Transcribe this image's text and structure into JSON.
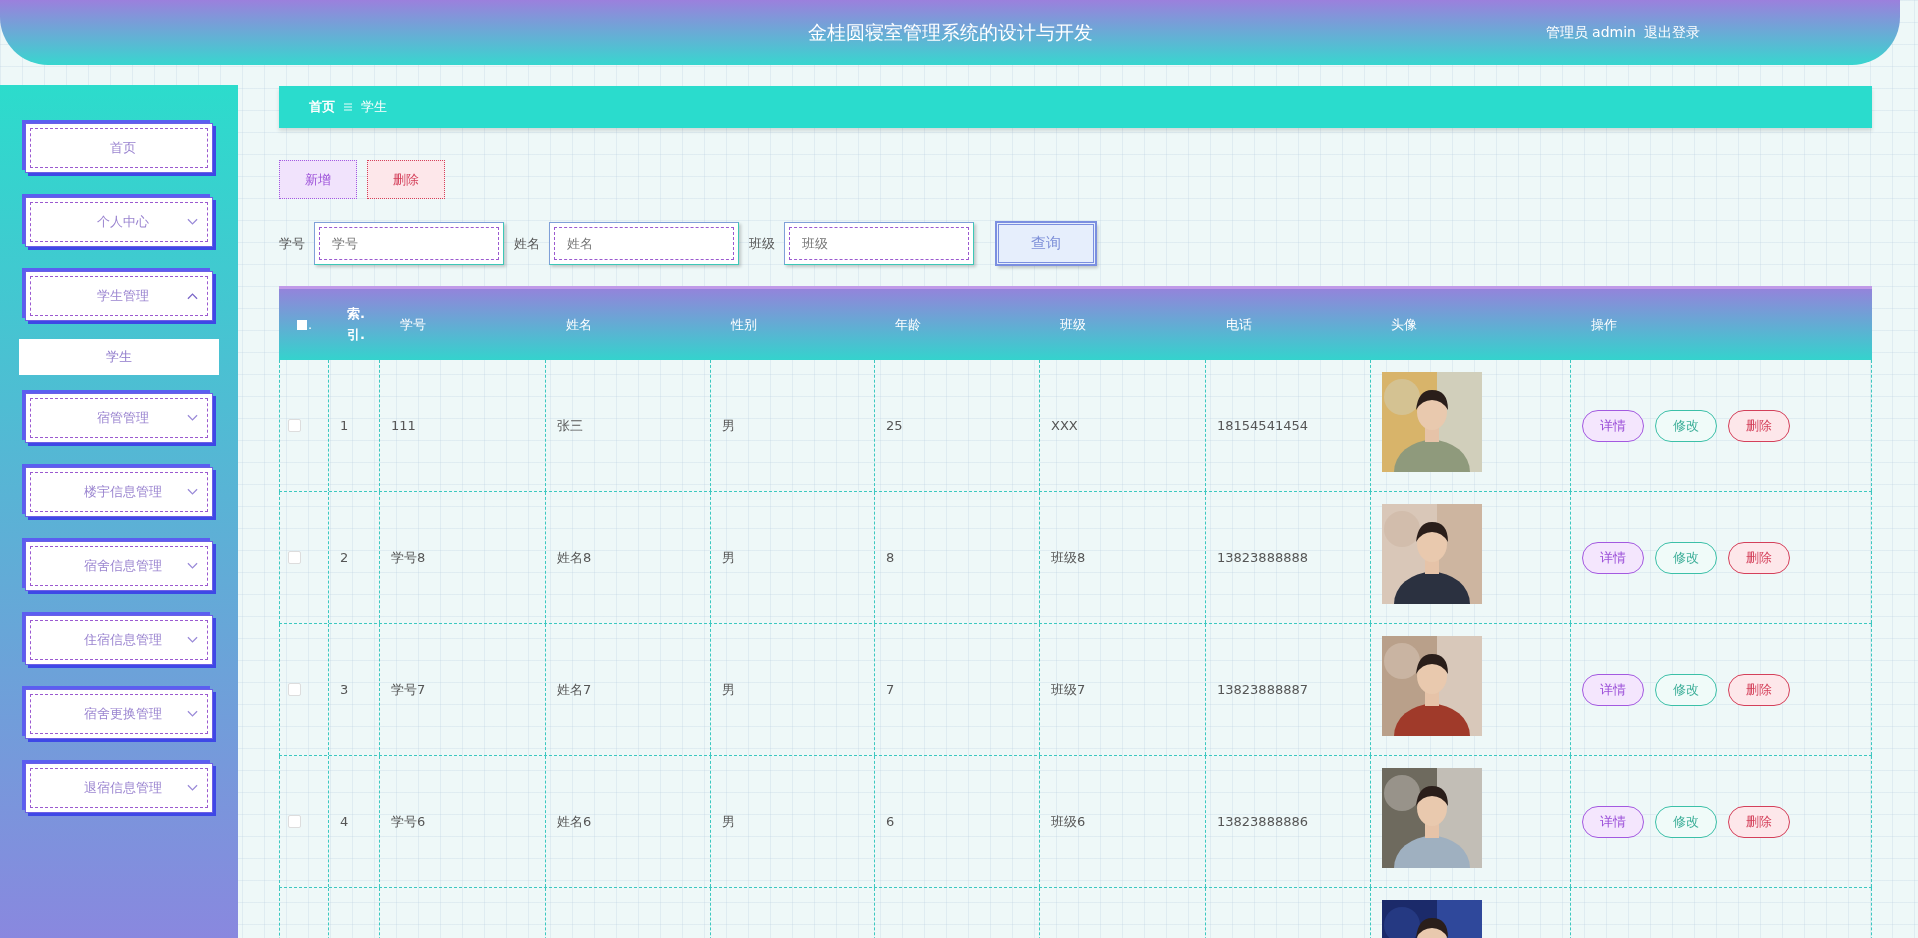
{
  "header": {
    "title": "金桂圆寝室管理系统的设计与开发",
    "user": "管理员 admin",
    "logout": "退出登录"
  },
  "sidebar": {
    "items": [
      {
        "label": "首页",
        "kind": "link"
      },
      {
        "label": "个人中心",
        "kind": "menu",
        "expanded": false
      },
      {
        "label": "学生管理",
        "kind": "menu",
        "expanded": true,
        "children": [
          {
            "label": "学生",
            "selected": true
          }
        ]
      },
      {
        "label": "宿管管理",
        "kind": "menu",
        "expanded": false
      },
      {
        "label": "楼宇信息管理",
        "kind": "menu",
        "expanded": false
      },
      {
        "label": "宿舍信息管理",
        "kind": "menu",
        "expanded": false
      },
      {
        "label": "住宿信息管理",
        "kind": "menu",
        "expanded": false
      },
      {
        "label": "宿舍更换管理",
        "kind": "menu",
        "expanded": false
      },
      {
        "label": "退宿信息管理",
        "kind": "menu",
        "expanded": false
      }
    ]
  },
  "breadcrumb": [
    "首页",
    "学生"
  ],
  "actions": [
    {
      "label": "新增",
      "kind": "add"
    },
    {
      "label": "删除",
      "kind": "delete"
    }
  ],
  "search": {
    "fields": [
      {
        "label": "学号",
        "placeholder": "学号"
      },
      {
        "label": "姓名",
        "placeholder": "姓名"
      },
      {
        "label": "班级",
        "placeholder": "班级"
      }
    ],
    "button": "查询"
  },
  "table": {
    "select_all": {
      "checked": false,
      "label": "."
    },
    "columns": [
      "索.引.",
      "学号",
      "姓名",
      "性别",
      "年龄",
      "班级",
      "电话",
      "头像",
      "操作"
    ],
    "rows": [
      {
        "checked": false,
        "index": "1",
        "id": "111",
        "name": "张三",
        "gender": "男",
        "age": "25",
        "class": "XXX",
        "phone": "18154541454",
        "photo": {
          "kind": "picture"
        },
        "actions": [
          "详情",
          "修改",
          "删除"
        ]
      },
      {
        "checked": false,
        "index": "2",
        "id": "学号8",
        "name": "姓名8",
        "gender": "男",
        "age": "8",
        "class": "班级8",
        "phone": "13823888888",
        "photo": {
          "kind": "picture"
        },
        "actions": [
          "详情",
          "修改",
          "删除"
        ]
      },
      {
        "checked": false,
        "index": "3",
        "id": "学号7",
        "name": "姓名7",
        "gender": "男",
        "age": "7",
        "class": "班级7",
        "phone": "13823888887",
        "photo": {
          "kind": "picture"
        },
        "actions": [
          "详情",
          "修改",
          "删除"
        ]
      },
      {
        "checked": false,
        "index": "4",
        "id": "学号6",
        "name": "姓名6",
        "gender": "男",
        "age": "6",
        "class": "班级6",
        "phone": "13823888886",
        "photo": {
          "kind": "picture"
        },
        "actions": [
          "详情",
          "修改",
          "删除"
        ]
      },
      {
        "photo": {
          "kind": "picture"
        }
      }
    ]
  }
}
